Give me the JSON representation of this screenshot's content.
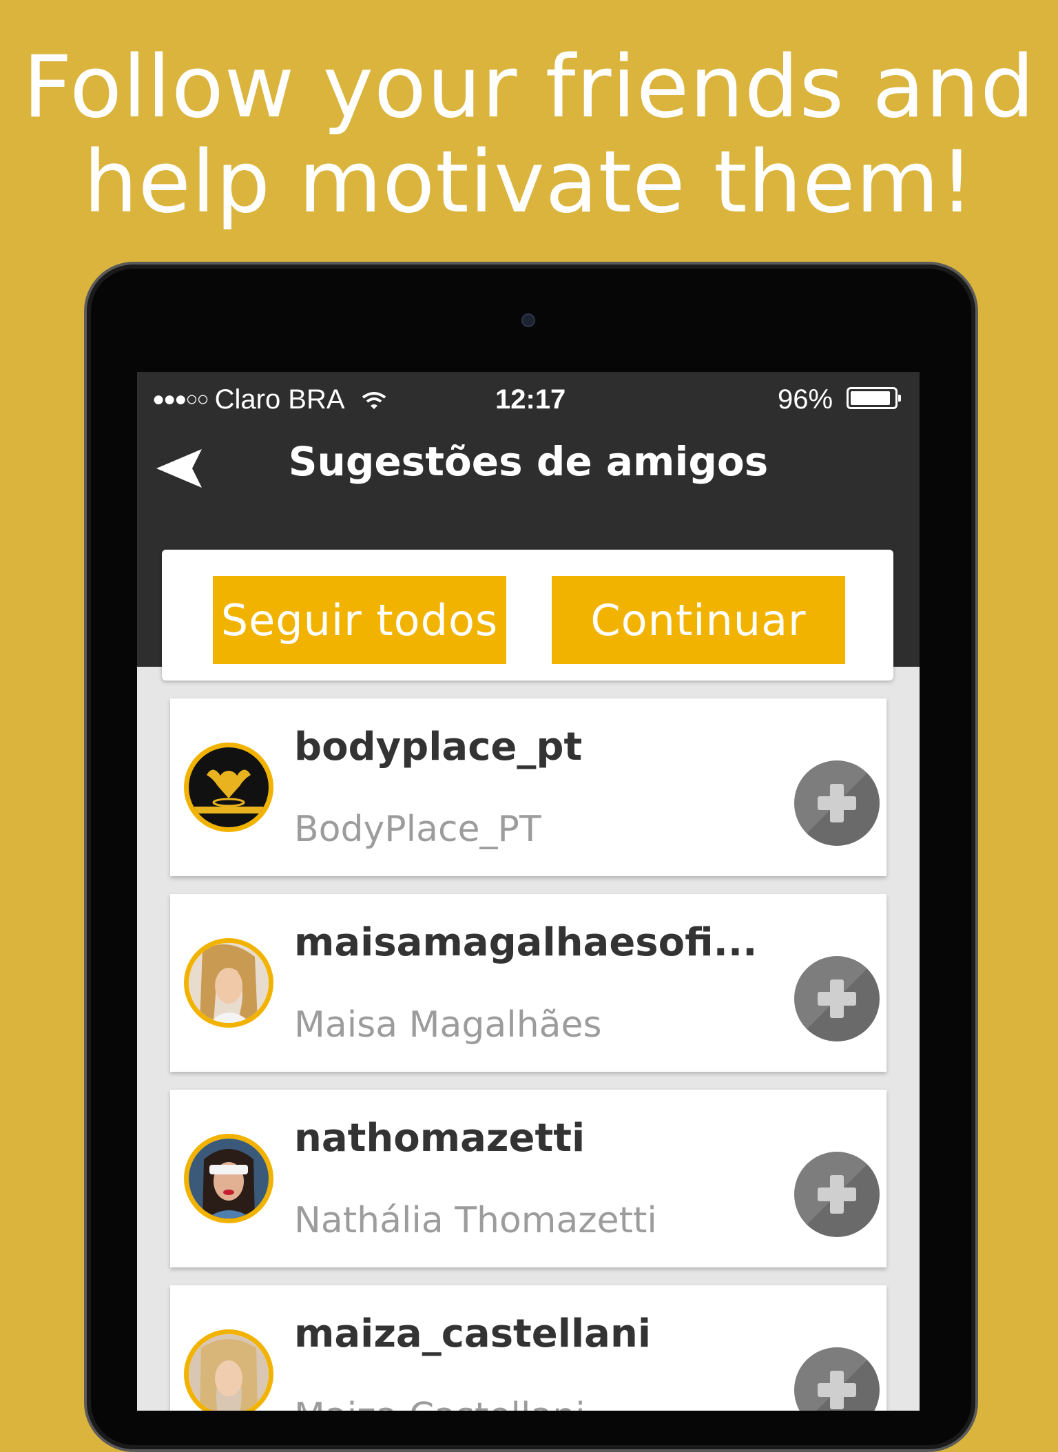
{
  "headline": {
    "line1": "Follow your friends and",
    "line2": "help motivate them!"
  },
  "status_bar": {
    "carrier": "Claro BRA",
    "time": "12:17",
    "battery": "96%",
    "battery_level": 0.96
  },
  "nav": {
    "title": "Sugestões de amigos",
    "back_icon": "back-arrow-icon"
  },
  "actions": {
    "follow_all_label": "Seguir todos",
    "continue_label": "Continuar"
  },
  "colors": {
    "background": "#DAB43C",
    "accent": "#F2B300",
    "nav_bar": "#2E2E2E"
  },
  "suggestions": [
    {
      "username": "bodyplace_pt",
      "name": "BodyPlace_PT"
    },
    {
      "username": "maisamagalhaesofi...",
      "name": "Maisa Magalhães"
    },
    {
      "username": "nathomazetti",
      "name": "Nathália Thomazetti"
    },
    {
      "username": "maiza_castellani",
      "name": "Maiza Castellani"
    }
  ]
}
